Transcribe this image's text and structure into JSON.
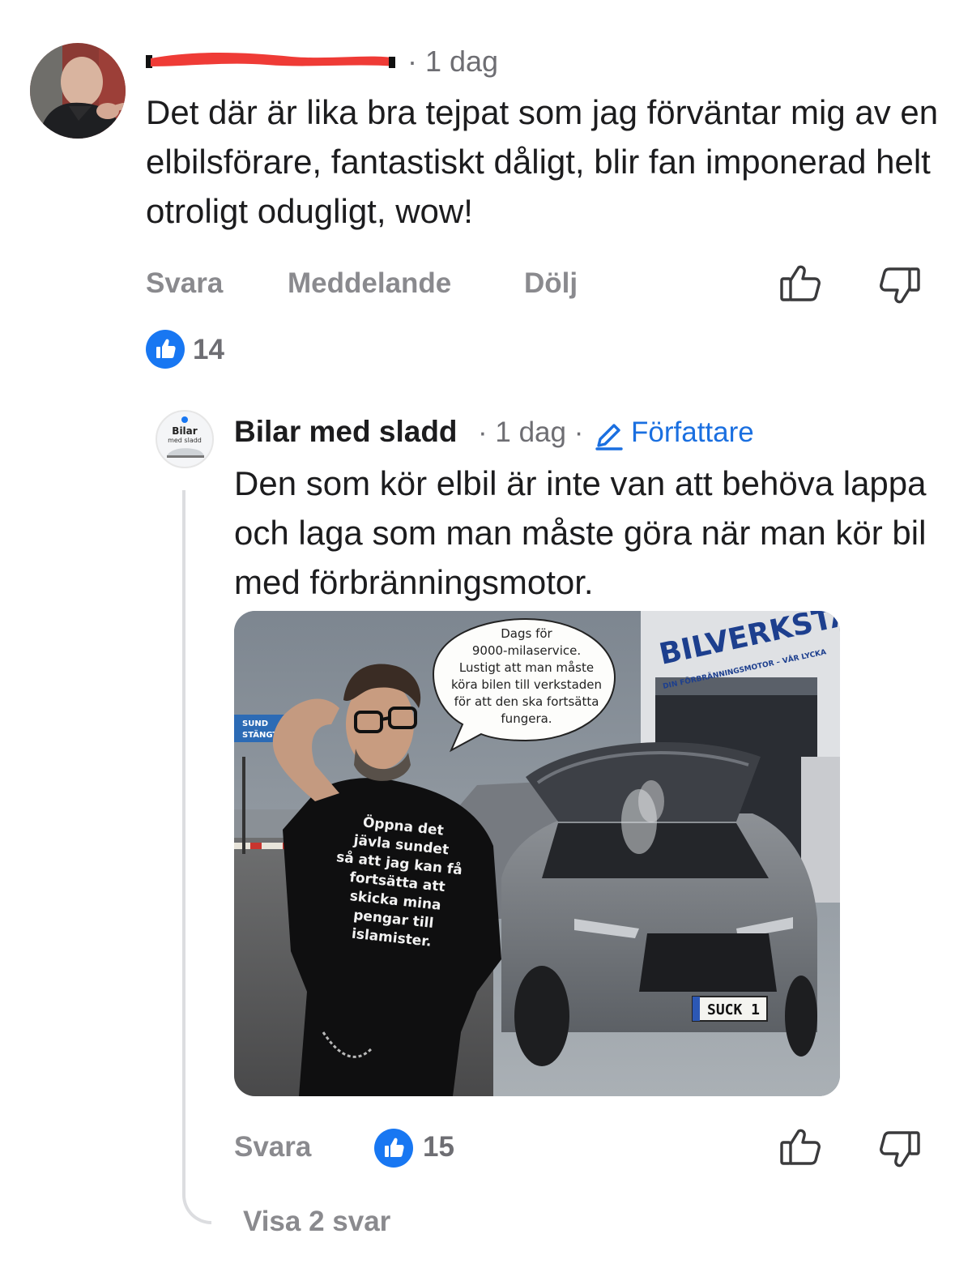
{
  "comment": {
    "time": "· 1 dag",
    "text": "Det där är lika bra tejpat som jag förväntar mig av en elbilsförare, fantastiskt dåligt, blir fan imponerad helt otroligt odugligt, wow!",
    "actions": {
      "reply": "Svara",
      "message": "Meddelande",
      "hide": "Dölj"
    },
    "like_count": "14"
  },
  "reply": {
    "author": "Bilar med sladd",
    "time": "· 1 dag ·",
    "author_badge": "Författare",
    "avatar_text_line1": "Bilar",
    "avatar_text_line2": "med sladd",
    "text": "Den som kör elbil är inte van att behöva lappa och laga som man måste göra när man kör bil med förbränningsmotor.",
    "image": {
      "speech_bubble": "Dags för\n9000-milaservice.\nLustigt att man måste\nköra bilen till verkstaden\nför att den ska fortsätta\nfungera.",
      "shirt_text": "Öppna det\njävla sundet\nså att jag kan få\nfortsätta att\nskicka mina\npengar till\nislamister.",
      "sign_main": "BILVERKSTAD",
      "sign_sub": "DIN FÖRBRÄNNINGSMOTOR – VÅR LYCKA",
      "road_sign_line1": "SUND",
      "road_sign_line2": "STÄNGT",
      "license_plate": "SUCK 1"
    },
    "actions": {
      "reply": "Svara"
    },
    "like_count": "15",
    "show_replies": "Visa 2 svar"
  },
  "colors": {
    "like_blue": "#1877f2",
    "author_blue": "#1a6fe0",
    "redaction_red": "#ef3b36",
    "muted_text": "#8a8a8e"
  },
  "icons": [
    "thumbs-up-icon",
    "thumbs-down-icon",
    "like-badge-icon",
    "pencil-icon"
  ]
}
